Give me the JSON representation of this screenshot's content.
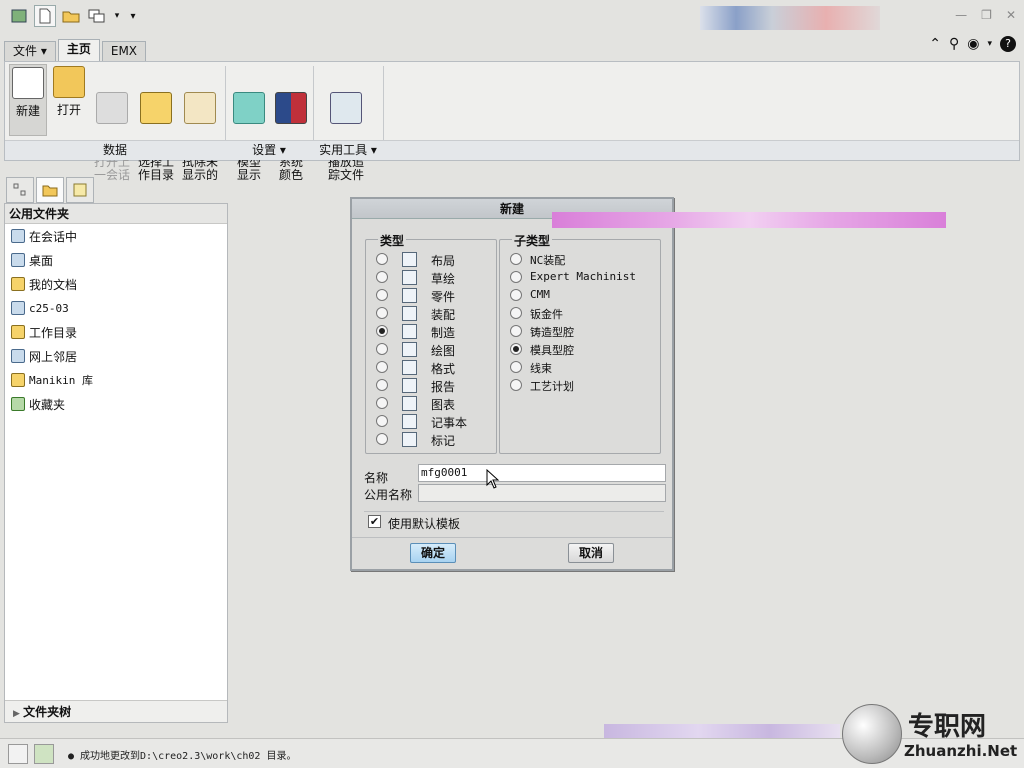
{
  "ribbon": {
    "tabs": [
      "文件 ▾",
      "主页",
      "EMX"
    ],
    "buttons": [
      {
        "label": "新建"
      },
      {
        "label": "打开"
      },
      {
        "label": "打开上\n一会话"
      },
      {
        "label": "选择工\n作目录"
      },
      {
        "label": "拭除未\n显示的"
      },
      {
        "label": "模型\n显示"
      },
      {
        "label": "系统\n颜色"
      },
      {
        "label": "播放追\n踪文件"
      }
    ],
    "groups": [
      "数据",
      "设置 ▾",
      "实用工具 ▾"
    ]
  },
  "nav": {
    "header": "公用文件夹",
    "items": [
      "在会话中",
      "桌面",
      "我的文档",
      "c25-03",
      "工作目录",
      "网上邻居",
      "Manikin 库",
      "收藏夹"
    ],
    "footer": "文件夹树"
  },
  "dialog": {
    "title": "新建",
    "type_legend": "类型",
    "types": [
      "布局",
      "草绘",
      "零件",
      "装配",
      "制造",
      "绘图",
      "格式",
      "报告",
      "图表",
      "记事本",
      "标记"
    ],
    "selected_type": "制造",
    "subtype_legend": "子类型",
    "subtypes": [
      "NC装配",
      "Expert Machinist",
      "CMM",
      "钣金件",
      "铸造型腔",
      "模具型腔",
      "线束",
      "工艺计划"
    ],
    "selected_subtype": "模具型腔",
    "name_label": "名称",
    "name_value": "mfg0001",
    "common_name_label": "公用名称",
    "common_name_value": "",
    "use_default_template_label": "使用默认模板",
    "use_default_template": true,
    "ok_label": "确定",
    "cancel_label": "取消"
  },
  "status": {
    "message": "● 成功地更改到D:\\creo2.3\\work\\ch02 目录。"
  },
  "watermark": {
    "brand": "专职网",
    "site": "Zhuanzhi.Net"
  }
}
